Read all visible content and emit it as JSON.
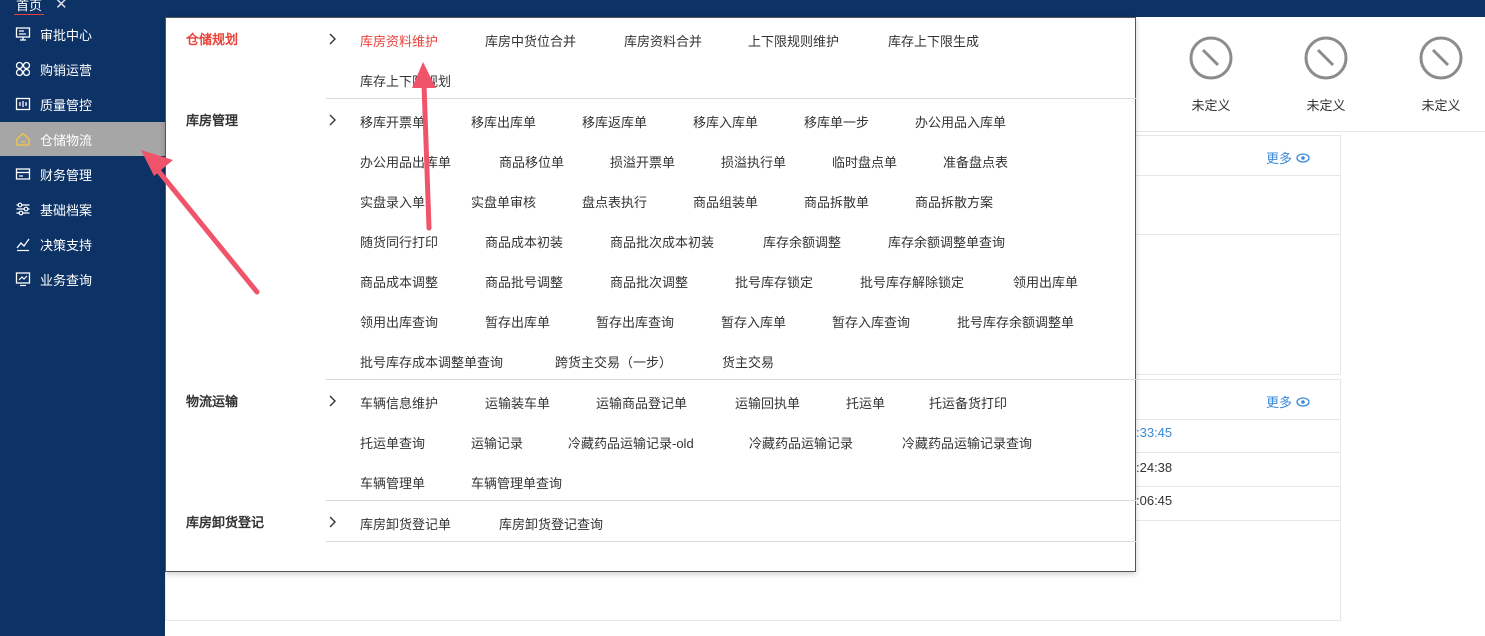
{
  "topbar": {
    "home_tab": "首页",
    "close_glyph": "✕"
  },
  "sidebar": {
    "items": [
      {
        "label": "审批中心",
        "icon": "monitor-icon"
      },
      {
        "label": "购销运营",
        "icon": "grid-icon"
      },
      {
        "label": "质量管控",
        "icon": "inspect-icon"
      },
      {
        "label": "仓储物流",
        "icon": "home-icon",
        "active": true
      },
      {
        "label": "财务管理",
        "icon": "card-icon"
      },
      {
        "label": "基础档案",
        "icon": "sliders-icon"
      },
      {
        "label": "决策支持",
        "icon": "trend-icon"
      },
      {
        "label": "业务查询",
        "icon": "chart-icon"
      }
    ]
  },
  "quick": [
    {
      "label": "未定义",
      "icon": "undefined-icon"
    },
    {
      "label": "未定义",
      "icon": "undefined-icon"
    },
    {
      "label": "未定义",
      "icon": "undefined-icon"
    }
  ],
  "panels": {
    "more_label": "更多"
  },
  "times": [
    ":33:45",
    ":24:38",
    ":06:45"
  ],
  "menu": {
    "categories": [
      {
        "name": "仓储规划",
        "items": [
          "库房资料维护",
          "库房中货位合并",
          "库房资料合并",
          "上下限规则维护",
          "库存上下限生成",
          "库存上下限规划"
        ]
      },
      {
        "name": "库房管理",
        "items": [
          "移库开票单",
          "移库出库单",
          "移库返库单",
          "移库入库单",
          "移库单一步",
          "办公用品入库单",
          "办公用品出库单",
          "商品移位单",
          "损溢开票单",
          "损溢执行单",
          "临时盘点单",
          "准备盘点表",
          "实盘录入单",
          "实盘单审核",
          "盘点表执行",
          "商品组装单",
          "商品拆散单",
          "商品拆散方案",
          "随货同行打印",
          "商品成本初装",
          "商品批次成本初装",
          "库存余额调整",
          "库存余额调整单查询",
          "商品成本调整",
          "商品批号调整",
          "商品批次调整",
          "批号库存锁定",
          "批号库存解除锁定",
          "领用出库单",
          "领用出库查询",
          "暂存出库单",
          "暂存出库查询",
          "暂存入库单",
          "暂存入库查询",
          "批号库存余额调整单",
          "批号库存成本调整单查询",
          "跨货主交易（一步）",
          "货主交易"
        ]
      },
      {
        "name": "物流运输",
        "items": [
          "车辆信息维护",
          "运输装车单",
          "运输商品登记单",
          "运输回执单",
          "托运单",
          "托运备货打印",
          "托运单查询",
          "运输记录",
          "冷藏药品运输记录-old",
          "冷藏药品运输记录",
          "冷藏药品运输记录查询",
          "车辆管理单",
          "车辆管理单查询"
        ]
      },
      {
        "name": "库房卸货登记",
        "items": [
          "库房卸货登记单",
          "库房卸货登记查询"
        ]
      }
    ]
  },
  "colors": {
    "nav_bg": "#0d3266",
    "active_red": "#e8433a",
    "link_blue": "#3a89d8",
    "arrow": "#f0546a"
  }
}
